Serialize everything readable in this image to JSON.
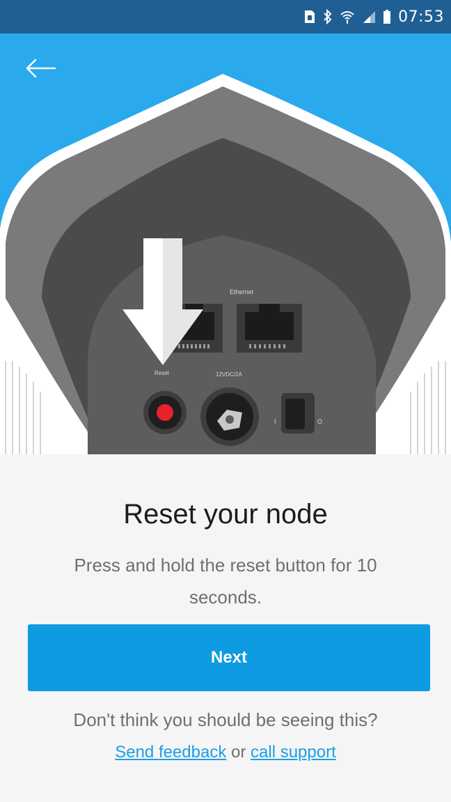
{
  "status_bar": {
    "time": "07:53",
    "icons": [
      "sim-icon",
      "bluetooth-icon",
      "wifi-icon",
      "signal-icon",
      "battery-icon"
    ]
  },
  "hero": {
    "background_color": "#2aa9ec",
    "back_icon": "arrow-left-icon",
    "illustration": {
      "port_label": "Ethernet",
      "reset_label": "Reset",
      "power_label": "12VDC/2A",
      "switch_on": "I",
      "switch_off": "O"
    }
  },
  "content": {
    "title": "Reset your node",
    "description": "Press and hold the reset button for 10 seconds.",
    "next_button": "Next",
    "help_question": "Don't think you should be seeing this?",
    "feedback_link": "Send feedback",
    "or_text": " or ",
    "support_link": "call support"
  },
  "colors": {
    "status_bar": "#1f5f93",
    "accent": "#0e9be2",
    "link": "#1a9fe8"
  }
}
